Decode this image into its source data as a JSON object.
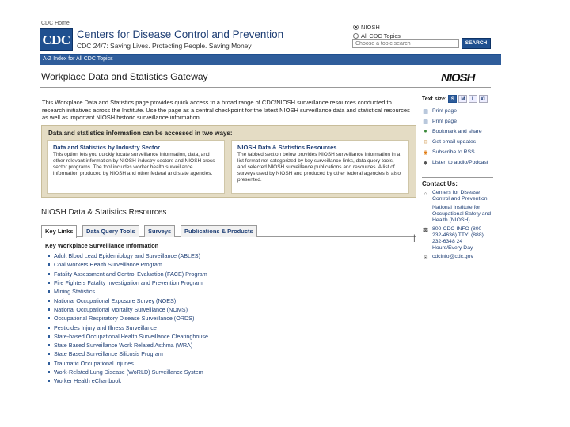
{
  "header": {
    "cdc_home": "CDC Home",
    "logo_text": "CDC",
    "org_name": "Centers for Disease Control and Prevention",
    "tagline": "CDC 24/7: Saving Lives. Protecting People. Saving Money",
    "search": {
      "options": [
        "NIOSH",
        "All CDC Topics"
      ],
      "selected": "NIOSH",
      "placeholder": "Choose a topic search",
      "button_label": "SEARCH"
    }
  },
  "navbar": {
    "link": "A-Z Index for All CDC Topics"
  },
  "page": {
    "title": "Workplace Data and Statistics Gateway",
    "niosh_logo": "NIOSH",
    "intro": "This Workplace Data and Statistics page provides quick access to a broad range of CDC/NIOSH surveillance resources conducted to research initiatives across the Institute. Use the page as a central checkpoint for the latest NIOSH surveillance data and statistical resources as well as important NIOSH historic surveillance information."
  },
  "info_box": {
    "header": "Data and statistics information can be accessed in two ways:",
    "left": {
      "title": "Data and Statistics by Industry Sector",
      "text": "This option lets you quickly locate surveillance information, data, and other relevant information by NIOSH industry sectors and NIOSH cross-sector programs. The tool includes worker health surveillance information produced by NIOSH and other federal and state agencies."
    },
    "right": {
      "title": "NIOSH Data & Statistics Resources",
      "text": "The tabbed section below provides NIOSH surveillance information in a list format not categorized by key surveillance links, data query tools, and selected NIOSH surveillance publications and resources. A list of surveys used by NIOSH and produced by other federal agencies is also presented."
    }
  },
  "sidebar": {
    "text_size_label": "Text size:",
    "text_sizes": [
      "S",
      "M",
      "L",
      "XL"
    ],
    "active_size": "S",
    "tools": [
      {
        "icon": "print-icon",
        "glyph": "▤",
        "label": "Print page",
        "color": "#4a6fa5"
      },
      {
        "icon": "print-icon",
        "glyph": "▤",
        "label": "Print page",
        "color": "#4a6fa5"
      },
      {
        "icon": "bookmark-icon",
        "glyph": "●",
        "label": "Bookmark and share",
        "color": "#3a8a3a"
      },
      {
        "icon": "email-icon",
        "glyph": "✉",
        "label": "Get email updates",
        "color": "#c27a1a"
      },
      {
        "icon": "rss-icon",
        "glyph": "◉",
        "label": "Subscribe to RSS",
        "color": "#e07a10"
      },
      {
        "icon": "podcast-icon",
        "glyph": "◆",
        "label": "Listen to audio/Podcast",
        "color": "#555555"
      }
    ],
    "contact_header": "Contact Us:",
    "contacts": [
      {
        "icon": "building-icon",
        "glyph": "⌂",
        "label": "Centers for Disease Control and Prevention"
      },
      {
        "icon": "",
        "glyph": "",
        "label": "National Institute for Occupational Safety and Health (NIOSH)"
      },
      {
        "icon": "phone-icon",
        "glyph": "☎",
        "label": "800-CDC-INFO (800-232-4636) TTY: (888) 232-6348 24 Hours/Every Day"
      },
      {
        "icon": "envelope-icon",
        "glyph": "✉",
        "label": "cdcinfo@cdc.gov"
      }
    ]
  },
  "resources": {
    "title": "NIOSH Data & Statistics Resources",
    "tabs": [
      "Key Links",
      "Data Query Tools",
      "Surveys",
      "Publications & Products"
    ],
    "active_tab": "Key Links",
    "section_header": "Key Workplace Surveillance Information",
    "items": [
      "Adult Blood Lead Epidemiology and Surveillance (ABLES)",
      "Coal Workers Health Surveillance Program",
      "Fatality Assessment and Control Evaluation (FACE) Program",
      "Fire Fighters Fatality Investigation and Prevention Program",
      "Mining Statistics",
      "National Occupational Exposure Survey (NOES)",
      "National Occupational Mortality Surveillance (NOMS)",
      "Occupational Respiratory Disease Surveillance (ORDS)",
      "Pesticides Injury and Illness Surveillance",
      "State-based Occupational Health Surveillance Clearinghouse",
      "State Based Surveillance Work Related Asthma (WRA)",
      "State Based Surveillance Silicosis Program",
      "Traumatic Occupational Injuries",
      "Work-Related Lung Disease (WoRLD) Surveillance System",
      "Worker Health eChartbook"
    ]
  }
}
